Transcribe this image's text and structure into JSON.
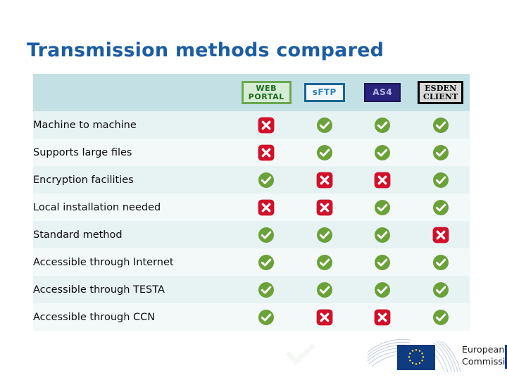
{
  "title": "Transmission methods compared",
  "colors": {
    "title_blue": "#1b5da4",
    "header_band": "#c3e1e4",
    "row_odd": "#e7f2f3",
    "row_even": "#f3f9f9",
    "check_green": "#6aa138",
    "cross_red": "#d2102a",
    "eu_blue": "#0f3b80"
  },
  "table": {
    "columns": [
      {
        "key": "feature",
        "label": ""
      },
      {
        "key": "web_portal",
        "label": "WEB\nPORTAL",
        "style": "badge-web",
        "icon_name": "web-portal-badge"
      },
      {
        "key": "sftp",
        "label": "sFTP",
        "style": "badge-sftp",
        "icon_name": "sftp-badge"
      },
      {
        "key": "as4",
        "label": "AS4",
        "style": "badge-as4",
        "icon_name": "as4-badge"
      },
      {
        "key": "esden_client",
        "label": "ESDEN\nCLIENT",
        "style": "badge-esden",
        "icon_name": "esden-client-badge"
      }
    ],
    "rows": [
      {
        "feature": "Machine to machine",
        "values": [
          "cross",
          "check",
          "check",
          "check"
        ]
      },
      {
        "feature": "Supports large files",
        "values": [
          "cross",
          "check",
          "check",
          "check"
        ]
      },
      {
        "feature": "Encryption facilities",
        "values": [
          "check",
          "cross",
          "cross",
          "check"
        ]
      },
      {
        "feature": "Local installation needed",
        "values": [
          "cross",
          "cross",
          "check",
          "check"
        ]
      },
      {
        "feature": "Standard method",
        "values": [
          "check",
          "check",
          "check",
          "cross"
        ]
      },
      {
        "feature": "Accessible through Internet",
        "values": [
          "check",
          "check",
          "check",
          "check"
        ]
      },
      {
        "feature": "Accessible through TESTA",
        "values": [
          "check",
          "check",
          "check",
          "check"
        ]
      },
      {
        "feature": "Accessible through CCN",
        "values": [
          "check",
          "cross",
          "cross",
          "check"
        ]
      }
    ],
    "legend": {
      "check": "supported",
      "cross": "not-supported"
    }
  },
  "footer": {
    "logo_line1": "European",
    "logo_line2": "Commission",
    "logo_name": "european-commission-logo"
  }
}
